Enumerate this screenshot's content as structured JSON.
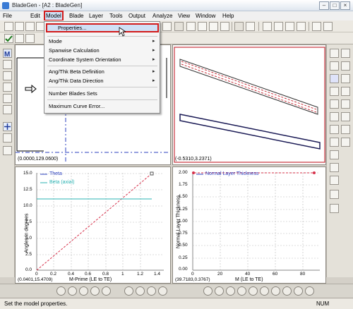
{
  "window": {
    "title": "BladeGen - [A2 : BladeGen]",
    "minimize_glyph": "–",
    "maximize_glyph": "□",
    "close_glyph": "×"
  },
  "menubar": {
    "items": [
      "File",
      "Edit",
      "Model",
      "Blade",
      "Layer",
      "Tools",
      "Output",
      "Analyze",
      "View",
      "Window",
      "Help"
    ],
    "active": "Model"
  },
  "model_menu": {
    "items": [
      {
        "label": "Properties...",
        "submenu": false,
        "highlighted": true
      },
      {
        "label": "Mode",
        "submenu": true
      },
      {
        "label": "Spanwise Calculation",
        "submenu": true
      },
      {
        "label": "Coordinate System Orientation",
        "submenu": true
      },
      {
        "label": "Ang/Thk Beta  Definition",
        "submenu": true
      },
      {
        "label": "Ang/Thk Data Direction",
        "submenu": true
      },
      {
        "label": "Number Blades Sets",
        "submenu": false
      },
      {
        "label": "Maximum Curve Error...",
        "submenu": false
      }
    ],
    "submenu_glyph": "▸"
  },
  "panes": {
    "meridional": {
      "coord": "(0.0000,129.0600)"
    },
    "blade_view": {
      "coord": "(-0.5310,3.2371)"
    },
    "angle": {
      "coord": "(0.0401,15.4709)",
      "xlabel": "M-Prime (LE to TE)",
      "ylabel": "Angles in degrees",
      "legend": [
        "Theta",
        "Beta (axial)"
      ],
      "xticks": [
        "0",
        "0.2",
        "0.4",
        "0.6",
        "0.8",
        "1",
        "1.2",
        "1.4"
      ],
      "yticks": [
        "15.0",
        "12.5",
        "10.0",
        "7.5",
        "5.0",
        "2.5",
        "0.0"
      ]
    },
    "thickness": {
      "coord": "(39.7183,0.3767)",
      "xlabel": "M (LE to TE)",
      "ylabel": "Normal Layer Thickness",
      "legend": [
        "Normal Layer Thickness"
      ],
      "xticks": [
        "0",
        "20",
        "40",
        "60",
        "80"
      ],
      "yticks": [
        "2.00",
        "1.75",
        "1.50",
        "1.25",
        "1.00",
        "0.75",
        "0.50",
        "0.25",
        "0.00"
      ]
    }
  },
  "statusbar": {
    "message": "Set the model properties.",
    "indicator": "NUM"
  },
  "colors": {
    "highlight_border": "#d21b1b",
    "theta": "#d6304a",
    "beta": "#2bb3b3",
    "blade_outline": "#1a1a55",
    "blade_fill_stroke": "#c8323c"
  }
}
